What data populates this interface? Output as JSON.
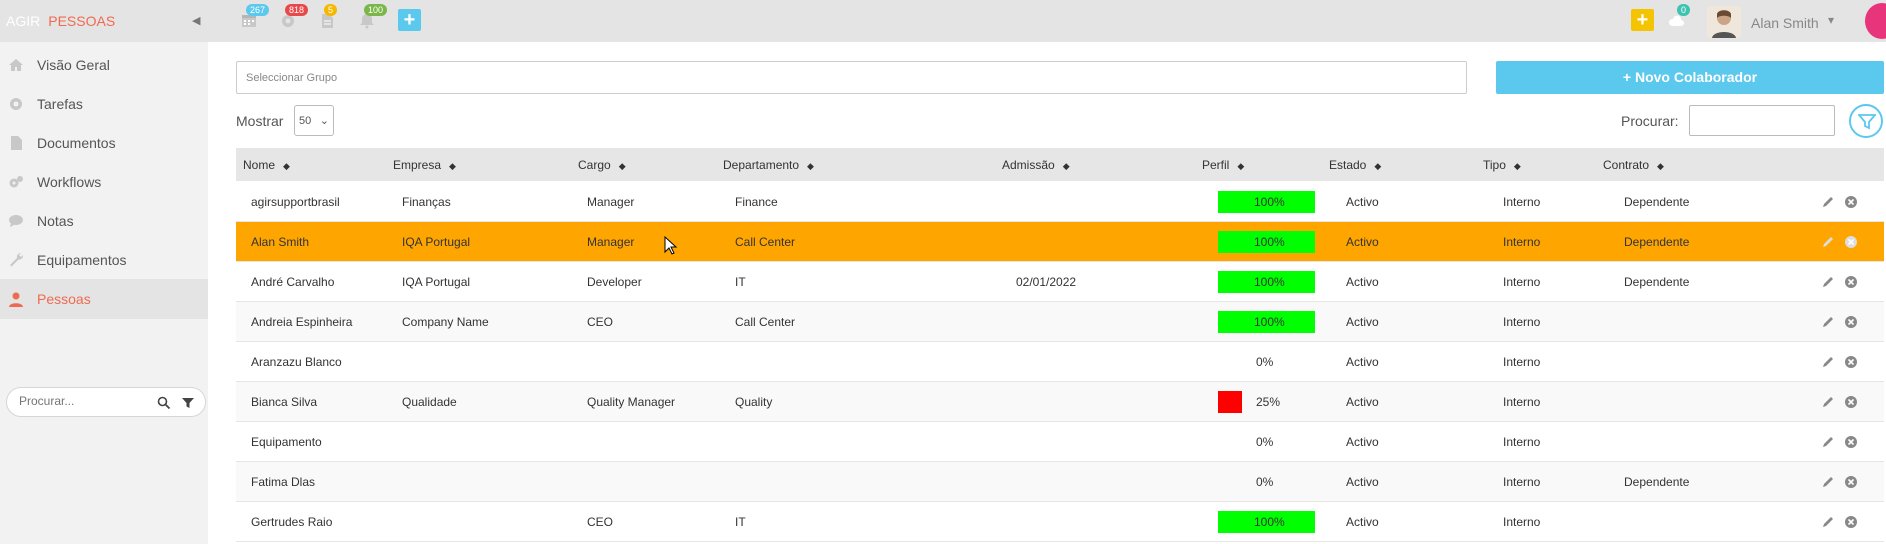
{
  "brand": {
    "part1": "AGIR",
    "part2": "PESSOAS"
  },
  "topbar": {
    "badges": [
      {
        "icon": "calendar-icon",
        "count": "267",
        "color": "#5bc8ee"
      },
      {
        "icon": "gear-icon",
        "count": "818",
        "color": "#e8484a"
      },
      {
        "icon": "document-icon",
        "count": "5",
        "color": "#f5b800"
      },
      {
        "icon": "bell-icon",
        "count": "100",
        "color": "#7ab648"
      }
    ],
    "cloud_badge": "0",
    "user_name": "Alan Smith"
  },
  "sidebar": {
    "items": [
      {
        "label": "Visão Geral",
        "icon": "home-icon"
      },
      {
        "label": "Tarefas",
        "icon": "gear-icon"
      },
      {
        "label": "Documentos",
        "icon": "document-icon"
      },
      {
        "label": "Workflows",
        "icon": "gears-icon"
      },
      {
        "label": "Notas",
        "icon": "chat-icon"
      },
      {
        "label": "Equipamentos",
        "icon": "wrench-icon"
      },
      {
        "label": "Pessoas",
        "icon": "person-icon"
      }
    ],
    "search_placeholder": "Procurar..."
  },
  "main": {
    "group_placeholder": "Seleccionar Grupo",
    "new_button": "Novo Colaborador",
    "show_label": "Mostrar",
    "show_value": "50",
    "search_label": "Procurar:",
    "columns": [
      "Nome",
      "Empresa",
      "Cargo",
      "Departamento",
      "Admissão",
      "Perfil",
      "Estado",
      "Tipo",
      "Contrato"
    ],
    "rows": [
      {
        "nome": "agirsupportbrasil",
        "empresa": "Finanças",
        "cargo": "Manager",
        "departamento": "Finance",
        "admissao": "",
        "perfil": 100,
        "perfil_text": "100%",
        "estado": "Activo",
        "tipo": "Interno",
        "contrato": "Dependente"
      },
      {
        "nome": "Alan Smith",
        "empresa": "IQA Portugal",
        "cargo": "Manager",
        "departamento": "Call Center",
        "admissao": "",
        "perfil": 100,
        "perfil_text": "100%",
        "estado": "Activo",
        "tipo": "Interno",
        "contrato": "Dependente"
      },
      {
        "nome": "André Carvalho",
        "empresa": "IQA Portugal",
        "cargo": "Developer",
        "departamento": "IT",
        "admissao": "02/01/2022",
        "perfil": 100,
        "perfil_text": "100%",
        "estado": "Activo",
        "tipo": "Interno",
        "contrato": "Dependente"
      },
      {
        "nome": "Andreia Espinheira",
        "empresa": "Company Name",
        "cargo": "CEO",
        "departamento": "Call Center",
        "admissao": "",
        "perfil": 100,
        "perfil_text": "100%",
        "estado": "Activo",
        "tipo": "Interno",
        "contrato": ""
      },
      {
        "nome": "Aranzazu Blanco",
        "empresa": "",
        "cargo": "",
        "departamento": "",
        "admissao": "",
        "perfil": 0,
        "perfil_text": "0%",
        "estado": "Activo",
        "tipo": "Interno",
        "contrato": ""
      },
      {
        "nome": "Bianca Silva",
        "empresa": "Qualidade",
        "cargo": "Quality Manager",
        "departamento": "Quality",
        "admissao": "",
        "perfil": 25,
        "perfil_text": "25%",
        "estado": "Activo",
        "tipo": "Interno",
        "contrato": ""
      },
      {
        "nome": "Equipamento",
        "empresa": "",
        "cargo": "",
        "departamento": "",
        "admissao": "",
        "perfil": 0,
        "perfil_text": "0%",
        "estado": "Activo",
        "tipo": "Interno",
        "contrato": ""
      },
      {
        "nome": "Fatima Dlas",
        "empresa": "",
        "cargo": "",
        "departamento": "",
        "admissao": "",
        "perfil": 0,
        "perfil_text": "0%",
        "estado": "Activo",
        "tipo": "Interno",
        "contrato": "Dependente"
      },
      {
        "nome": "Gertrudes Raio",
        "empresa": "",
        "cargo": "CEO",
        "departamento": "IT",
        "admissao": "",
        "perfil": 100,
        "perfil_text": "100%",
        "estado": "Activo",
        "tipo": "Interno",
        "contrato": ""
      }
    ],
    "selected_row": 1
  },
  "colors": {
    "accent": "#f06a50",
    "primary": "#5bc8ee",
    "selected_row": "#ffa500",
    "perfil_full": "#00ff00",
    "perfil_low": "#ff0000"
  }
}
